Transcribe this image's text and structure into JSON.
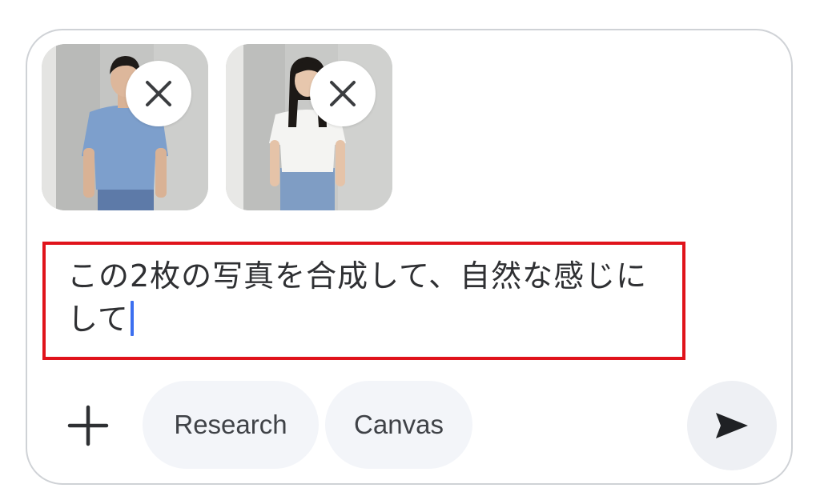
{
  "attachments": [
    {
      "description": "photo of a man in a blue t-shirt and jeans",
      "remove_icon": "close-icon"
    },
    {
      "description": "photo of a woman in a white t-shirt and jeans",
      "remove_icon": "close-icon"
    }
  ],
  "prompt": {
    "text": "この2枚の写真を合成して、自然な感じにして",
    "highlight_color": "#e0131b",
    "caret_color": "#3c6ff0"
  },
  "toolbar": {
    "add_icon": "plus-icon",
    "chips": [
      "Research",
      "Canvas"
    ],
    "send_icon": "send-icon"
  }
}
